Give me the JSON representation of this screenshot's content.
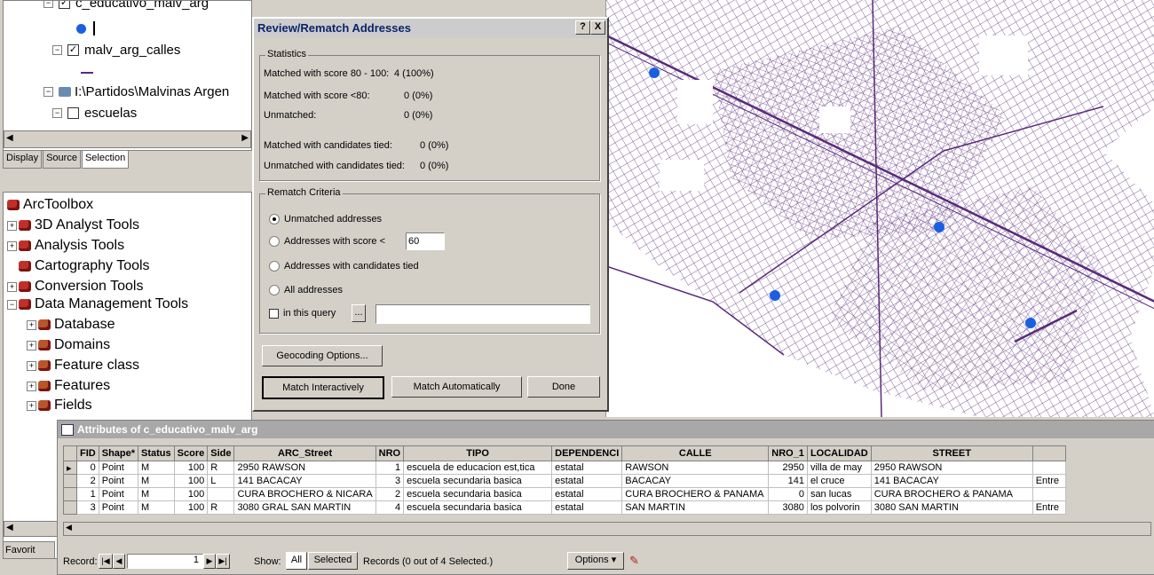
{
  "toc": {
    "layer1": "c_educativo_malv_arg",
    "layer2": "malv_arg_calles",
    "source_path": "I:\\Partidos\\Malvinas Argen",
    "layer3": "escuelas",
    "tabs": [
      "Display",
      "Source",
      "Selection"
    ]
  },
  "toolbox": {
    "root": "ArcToolbox",
    "items": [
      "3D Analyst Tools",
      "Analysis Tools",
      "Cartography Tools",
      "Conversion Tools",
      "Data Management Tools"
    ],
    "subitems": [
      "Database",
      "Domains",
      "Feature class",
      "Features",
      "Fields"
    ]
  },
  "dialog": {
    "title": "Review/Rematch Addresses",
    "help": "?",
    "close": "X",
    "statistics_label": "Statistics",
    "stats": [
      {
        "label": "Matched with score 80 - 100:",
        "value": "4 (100%)"
      },
      {
        "label": "Matched with score <80:",
        "value": "0 (0%)"
      },
      {
        "label": "Unmatched:",
        "value": "0 (0%)"
      },
      {
        "label": "Matched with candidates tied:",
        "value": "0 (0%)"
      },
      {
        "label": "Unmatched with candidates tied:",
        "value": "0 (0%)"
      }
    ],
    "rematch_label": "Rematch Criteria",
    "radios": [
      "Unmatched addresses",
      "Addresses with score <",
      "Addresses with candidates tied",
      "All addresses"
    ],
    "score_value": "60",
    "query_label": "in this query",
    "query_btn": "...",
    "geocoding_options": "Geocoding Options...",
    "match_interactively": "Match Interactively",
    "match_automatically": "Match Automatically",
    "done": "Done"
  },
  "attributes": {
    "title": "Attributes of c_educativo_malv_arg",
    "columns": [
      "FID",
      "Shape*",
      "Status",
      "Score",
      "Side",
      "ARC_Street",
      "NRO",
      "TIPO",
      "DEPENDENCI",
      "CALLE",
      "NRO_1",
      "LOCALIDAD",
      "STREET",
      ""
    ],
    "rows": [
      [
        "0",
        "Point",
        "M",
        "100",
        "R",
        "2950 RAWSON",
        "1",
        "escuela de educacion est,tica",
        "estatal",
        "RAWSON",
        "2950",
        "villa de may",
        "2950 RAWSON",
        ""
      ],
      [
        "2",
        "Point",
        "M",
        "100",
        "L",
        "141 BACACAY",
        "3",
        "escuela secundaria basica",
        "estatal",
        "BACACAY",
        "141",
        "el cruce",
        "141 BACACAY",
        "Entre"
      ],
      [
        "1",
        "Point",
        "M",
        "100",
        "",
        "CURA BROCHERO & NICARA",
        "2",
        "escuela secundaria basica",
        "estatal",
        "CURA BROCHERO & PANAMA",
        "0",
        "san lucas",
        "CURA BROCHERO & PANAMA",
        ""
      ],
      [
        "3",
        "Point",
        "M",
        "100",
        "R",
        "3080 GRAL SAN MARTIN",
        "4",
        "escuela secundaria basica",
        "estatal",
        "SAN MARTIN",
        "3080",
        "los polvorin",
        "3080 SAN MARTIN",
        "Entre"
      ]
    ],
    "record_label": "Record:",
    "record_value": "1",
    "show_label": "Show:",
    "all": "All",
    "selected": "Selected",
    "records_text": "Records (0 out of 4 Selected.)",
    "options": "Options",
    "favorites_tab": "Favorit"
  },
  "colors": {
    "street": "#5a2a7a",
    "point": "#1a5fe0"
  }
}
